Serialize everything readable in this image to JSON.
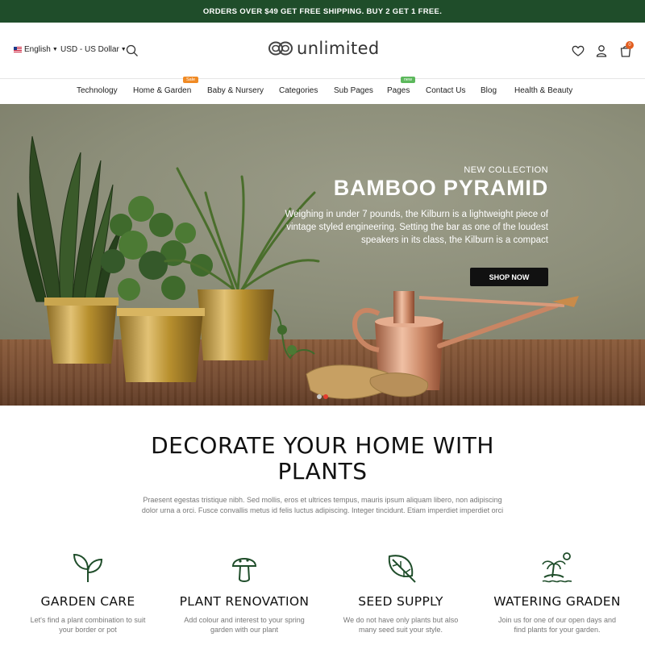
{
  "promo_bar": {
    "text": "ORDERS OVER $49 GET FREE SHIPPING. BUY 2 GET 1 FREE."
  },
  "header": {
    "language": "English",
    "currency": "USD - US Dollar",
    "logo_text": "unlimited",
    "cart_count": "0"
  },
  "nav": {
    "items": [
      {
        "label": "Technology"
      },
      {
        "label": "Home & Garden",
        "badge": "Sale",
        "badge_color": "#f08a24"
      },
      {
        "label": "Baby & Nursery"
      },
      {
        "label": "Categories"
      },
      {
        "label": "Sub Pages"
      },
      {
        "label": "Pages",
        "badge": "new",
        "badge_color": "#5cb85c"
      },
      {
        "label": "Contact Us"
      },
      {
        "label": "Blog"
      },
      {
        "label": "Health & Beauty"
      }
    ]
  },
  "hero": {
    "eyebrow": "NEW COLLECTION",
    "title": "BAMBOO PYRAMID",
    "text": "Weighing in under 7 pounds, the Kilburn is a lightweight piece of vintage styled engineering. Setting the bar as one of the loudest speakers in its class, the Kilburn is a compact",
    "button": "SHOP NOW",
    "active_slide": 2,
    "slide_count": 2
  },
  "section": {
    "title_line1": "DECORATE YOUR HOME WITH",
    "title_line2": "PLANTS",
    "text": "Praesent egestas tristique nibh. Sed mollis, eros et ultrices tempus, mauris ipsum aliquam libero, non adipiscing dolor urna a orci. Fusce convallis metus id felis luctus adipiscing. Integer tincidunt. Etiam imperdiet imperdiet orci"
  },
  "features": [
    {
      "icon": "sprout-icon",
      "title": "GARDEN CARE",
      "text": "Let's find a plant combination to suit your border or pot"
    },
    {
      "icon": "mushroom-icon",
      "title": "PLANT RENOVATION",
      "text": "Add colour and interest to your spring garden with our plant"
    },
    {
      "icon": "leaf-icon",
      "title": "SEED SUPPLY",
      "text": "We do not have only plants but also many seed suit your style."
    },
    {
      "icon": "palm-island-icon",
      "title": "WATERING GRADEN",
      "text": "Join us for one of our open days and find plants for your garden."
    }
  ],
  "colors": {
    "promo_bg": "#1f4d2a",
    "accent": "#1f4d2a",
    "cart_badge": "#e25d1f"
  }
}
